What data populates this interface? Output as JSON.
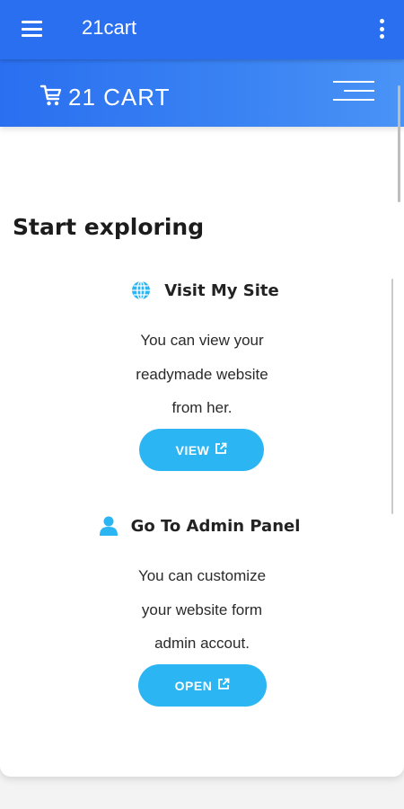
{
  "appbar": {
    "title": "21cart",
    "menu_icon": "hamburger-menu-icon",
    "overflow_icon": "more-vertical-icon"
  },
  "site_header": {
    "logo_text": "21 CART",
    "logo_icon": "cart-icon",
    "nav_toggle_icon": "nav-menu-icon"
  },
  "main": {
    "section_title": "Start exploring",
    "features": [
      {
        "title": "Visit My Site",
        "icon": "globe-icon",
        "lines": [
          "You can view your",
          "readymade website",
          "from her."
        ],
        "button_label": "VIEW",
        "button_icon": "external-link-icon"
      },
      {
        "title": "Go To Admin Panel",
        "icon": "user-icon",
        "lines": [
          "You can customize",
          "your website form",
          "admin accout."
        ],
        "button_label": "OPEN",
        "button_icon": "external-link-icon"
      }
    ]
  },
  "colors": {
    "appbar": "#2a6ff0",
    "accent": "#2bb6f3",
    "background": "#f3f3f3"
  }
}
